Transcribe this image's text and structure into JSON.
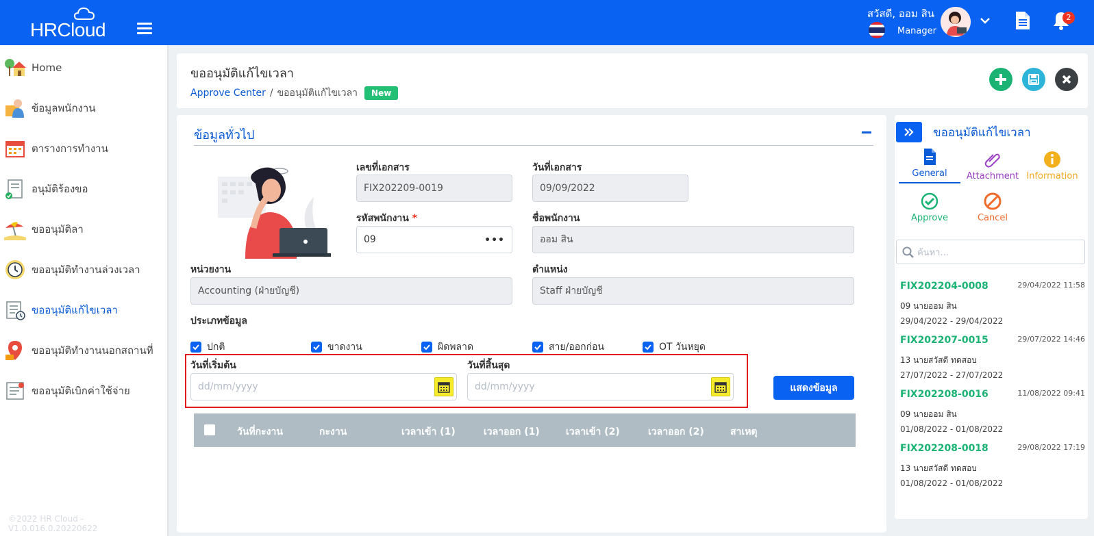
{
  "app": {
    "logo": "HRCloud"
  },
  "header": {
    "greeting": "สวัสดี, ออม สิน",
    "role": "Manager",
    "notification_count": "2"
  },
  "sidebar": {
    "items": [
      {
        "label": "Home",
        "icon": "house-tree-icon"
      },
      {
        "label": "ข้อมูลพนักงาน",
        "icon": "employee-icon"
      },
      {
        "label": "ตารางการทำงาน",
        "icon": "calendar-icon"
      },
      {
        "label": "อนุมัติร้องขอ",
        "icon": "approve-doc-icon"
      },
      {
        "label": "ขออนุมัติลา",
        "icon": "beach-icon"
      },
      {
        "label": "ขออนุมัติทำงานล่วงเวลา",
        "icon": "clock-icon"
      },
      {
        "label": "ขออนุมัติแก้ไขเวลา",
        "icon": "edit-time-icon"
      },
      {
        "label": "ขออนุมัติทำงานนอกสถานที่",
        "icon": "location-icon"
      },
      {
        "label": "ขออนุมัติเบิกค่าใช้จ่าย",
        "icon": "expense-icon"
      }
    ],
    "active_index": 6,
    "copyright": "©2022 HR Cloud -V1.0.016.0.20220622"
  },
  "page": {
    "title": "ขออนุมัติแก้ไขเวลา",
    "breadcrumb_link": "Approve Center",
    "breadcrumb_sep": "/",
    "breadcrumb_current": "ขออนุมัติแก้ไขเวลา",
    "status": "New"
  },
  "form": {
    "section_title": "ข้อมูลทั่วไป",
    "doc_no_label": "เลขที่เอกสาร",
    "doc_no": "FIX202209-0019",
    "doc_date_label": "วันที่เอกสาร",
    "doc_date": "09/09/2022",
    "emp_code_label": "รหัสพนักงาน",
    "required_mark": "*",
    "emp_code": "09",
    "emp_code_more": "•••",
    "emp_name_label": "ชื่อพนักงาน",
    "emp_name": "ออม สิน",
    "dept_label": "หน่วยงาน",
    "dept": "Accounting (ฝ่ายบัญชี)",
    "position_label": "ตำแหน่ง",
    "position": "Staff ฝ่ายบัญชี",
    "data_type_label": "ประเภทข้อมูล",
    "data_types": [
      "ปกติ",
      "ขาดงาน",
      "ผิดพลาด",
      "สาย/ออกก่อน",
      "OT วันหยุด"
    ],
    "start_date_label": "วันที่เริ่มต้น",
    "end_date_label": "วันที่สิ้นสุด",
    "date_placeholder": "dd/mm/yyyy",
    "show_button": "แสดงข้อมูล"
  },
  "table": {
    "columns": [
      "วันที่กะงาน",
      "กะงาน",
      "เวลาเข้า (1)",
      "เวลาออก (1)",
      "เวลาเข้า (2)",
      "เวลาออก (2)",
      "สาเหตุ"
    ]
  },
  "right_panel": {
    "title": "ขออนุมัติแก้ไขเวลา",
    "tabs": [
      {
        "label": "General",
        "color": "#0a5bd8"
      },
      {
        "label": "Attachment",
        "color": "#9b3fc4"
      },
      {
        "label": "Information",
        "color": "#f2a81d"
      },
      {
        "label": "Approve",
        "color": "#1ab373"
      },
      {
        "label": "Cancel",
        "color": "#f36b2b"
      }
    ],
    "search_placeholder": "ค้นหา...",
    "docs": [
      {
        "no": "FIX202204-0008",
        "datetime": "29/04/2022 11:58",
        "name": "09 นายออม สิน",
        "range": "29/04/2022 - 29/04/2022"
      },
      {
        "no": "FIX202207-0015",
        "datetime": "29/07/2022 14:46",
        "name": "13 นายสวัสดี ทดสอบ",
        "range": "27/07/2022 - 27/07/2022"
      },
      {
        "no": "FIX202208-0016",
        "datetime": "11/08/2022 09:41",
        "name": "09 นายออม สิน",
        "range": "01/08/2022 - 01/08/2022"
      },
      {
        "no": "FIX202208-0018",
        "datetime": "29/08/2022 17:19",
        "name": "13 นายสวัสดี ทดสอบ",
        "range": "01/08/2022 - 01/08/2022"
      }
    ]
  }
}
